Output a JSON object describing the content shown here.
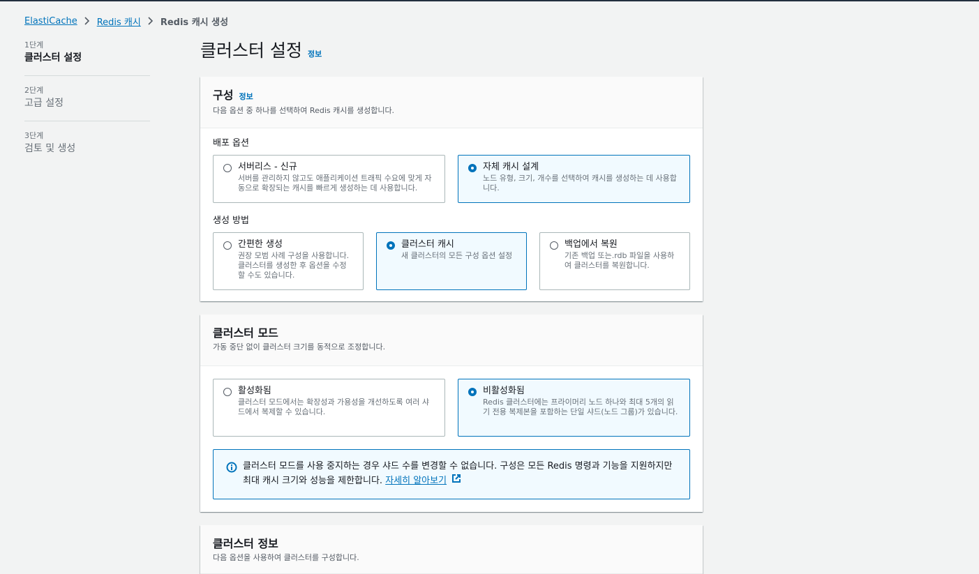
{
  "breadcrumb": {
    "items": [
      "ElastiCache",
      "Redis 캐시"
    ],
    "current": "Redis 캐시 생성"
  },
  "steps": [
    {
      "num": "1단계",
      "name": "클러스터 설정"
    },
    {
      "num": "2단계",
      "name": "고급 설정"
    },
    {
      "num": "3단계",
      "name": "검토 및 생성"
    }
  ],
  "page": {
    "title": "클러스터 설정",
    "info": "정보"
  },
  "config_panel": {
    "title": "구성",
    "info": "정보",
    "description": "다음 옵션 중 하나를 선택하여 Redis 캐시를 생성합니다.",
    "deploy_label": "배포 옵션",
    "deploy_options": [
      {
        "title": "서버리스 - 신규",
        "desc": "서버를 관리하지 않고도 애플리케이션 트래픽 수요에 맞게 자동으로 확장되는 캐시를 빠르게 생성하는 데 사용합니다."
      },
      {
        "title": "자체 캐시 설계",
        "desc": "노드 유형, 크기, 개수를 선택하여 캐시를 생성하는 데 사용합니다."
      }
    ],
    "method_label": "생성 방법",
    "method_options": [
      {
        "title": "간편한 생성",
        "desc": "권장 모범 사례 구성을 사용합니다. 클러스터를 생성한 후 옵션을 수정할 수도 있습니다."
      },
      {
        "title": "클러스터 캐시",
        "desc": "새 클러스터의 모든 구성 옵션 설정"
      },
      {
        "title": "백업에서 복원",
        "desc": "기존 백업 또는.rdb 파일을 사용하여 클러스터를 복원합니다."
      }
    ]
  },
  "mode_panel": {
    "title": "클러스터 모드",
    "description": "가동 중단 없이 클러스터 크기를 동적으로 조정합니다.",
    "options": [
      {
        "title": "활성화됨",
        "desc": "클러스터 모드에서는 확장성과 가용성을 개선하도록 여러 샤드에서 복제할 수 있습니다."
      },
      {
        "title": "비활성화됨",
        "desc": "Redis 클러스터에는 프라이머리 노드 하나와 최대 5개의 읽기 전용 복제본을 포함하는 단일 샤드(노드 그룹)가 있습니다."
      }
    ],
    "alert_text": "클러스터 모드를 사용 중지하는 경우 샤드 수를 변경할 수 없습니다. 구성은 모든 Redis 명령과 기능을 지원하지만 최대 캐시 크기와 성능을 제한합니다.",
    "alert_link": "자세히 알아보기"
  },
  "info_panel": {
    "title": "클러스터 정보",
    "description": "다음 옵션을 사용하여 클러스터를 구성합니다."
  },
  "colors": {
    "accent": "#0073bb",
    "selected_bg": "#f1faff",
    "page_bg": "#f2f3f3"
  }
}
